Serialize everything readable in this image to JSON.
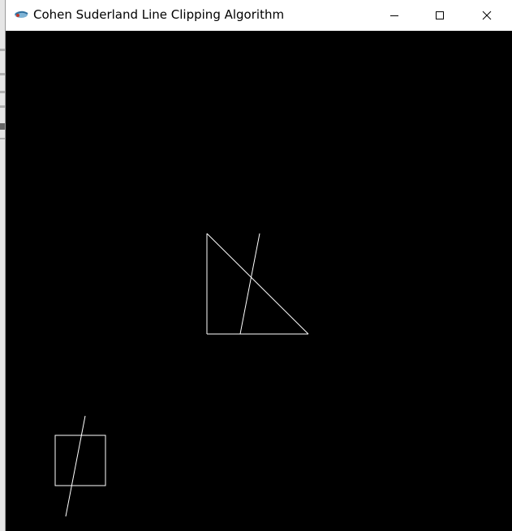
{
  "window": {
    "title": "Cohen Suderland Line Clipping Algorithm",
    "icon": "app-icon",
    "controls": {
      "minimize_icon": "minimize-icon",
      "maximize_icon": "maximize-icon",
      "close_icon": "close-icon"
    }
  },
  "canvas": {
    "background": "#000000",
    "stroke_color": "#ffffff"
  }
}
